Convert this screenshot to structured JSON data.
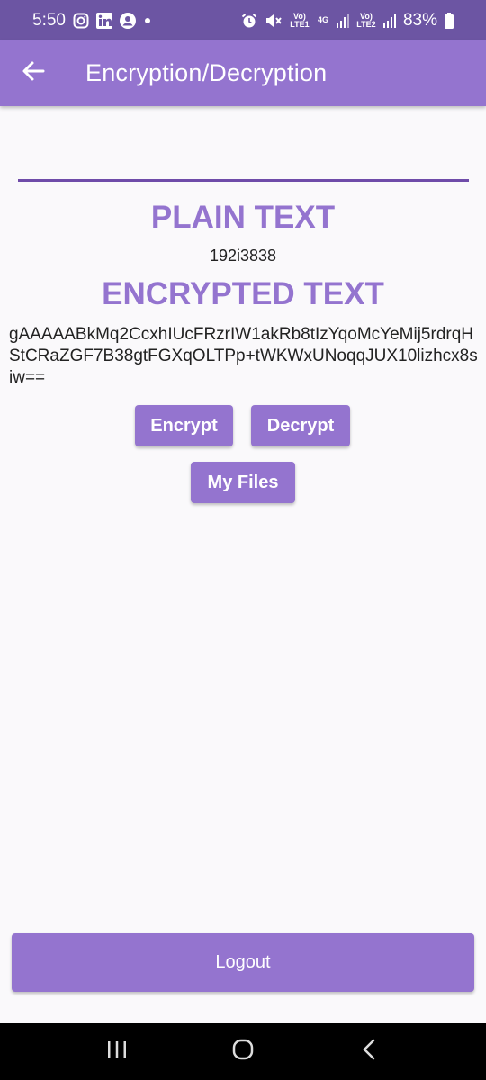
{
  "status_bar": {
    "time": "5:50",
    "battery": "83%",
    "lte1": "Vo) LTE1",
    "lte2": "Vo) LTE2",
    "network": "4G",
    "left_icons": [
      "instagram-icon",
      "linkedin-icon",
      "account-icon",
      "dot-icon"
    ],
    "right_icons": [
      "alarm-icon",
      "mute-icon",
      "signal-icon",
      "signal-icon",
      "battery-icon"
    ]
  },
  "app_bar": {
    "title": "Encryption/Decryption",
    "back_icon": "arrow-left-icon"
  },
  "plain": {
    "heading": "PLAIN TEXT",
    "value": "192i3838"
  },
  "encrypted": {
    "heading": "ENCRYPTED TEXT",
    "value": "gAAAAABkMq2CcxhIUcFRzrIW1akRb8tIzYqoMcYeMij5rdrqHStCRaZGF7B38gtFGXqOLTPp+tWKWxUNoqqJUX10lizhcx8siw=="
  },
  "buttons": {
    "encrypt": "Encrypt",
    "decrypt": "Decrypt",
    "my_files": "My Files",
    "logout": "Logout"
  },
  "colors": {
    "status_bar": "#6c55a3",
    "app_bar": "#9474cf",
    "accent": "#9474cf",
    "underline": "#6f4ca9",
    "background": "#faf9fb"
  },
  "nav": [
    "recent-apps-icon",
    "home-icon",
    "back-icon"
  ]
}
